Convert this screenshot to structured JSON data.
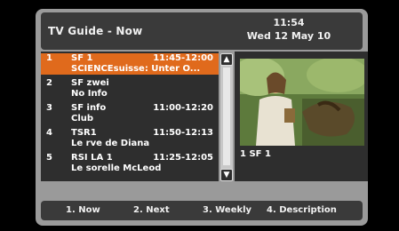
{
  "header": {
    "title": "TV Guide - Now",
    "time": "11:54",
    "date": "Wed 12 May 10"
  },
  "channels": [
    {
      "num": "1",
      "name": "SF 1",
      "time": "11:45-12:00",
      "program": "SCIENCEsuisse: Unter O...",
      "selected": true
    },
    {
      "num": "2",
      "name": "SF zwei",
      "time": "",
      "program": "No Info",
      "selected": false
    },
    {
      "num": "3",
      "name": "SF info",
      "time": "11:00-12:20",
      "program": "Club",
      "selected": false
    },
    {
      "num": "4",
      "name": "TSR1",
      "time": "11:50-12:13",
      "program": "Le rve de Diana",
      "selected": false
    },
    {
      "num": "5",
      "name": "RSI LA 1",
      "time": "11:25-12:05",
      "program": "Le sorelle McLeod",
      "selected": false
    }
  ],
  "preview": {
    "label": "1 SF 1"
  },
  "scrollbar": {
    "up_symbol": "▲",
    "down_symbol": "▼"
  },
  "footer": {
    "tabs": [
      "1. Now",
      "2. Next",
      "3. Weekly",
      "4. Description"
    ]
  },
  "colors": {
    "selected_row": "#e06a1c",
    "panel": "#2e2e2e",
    "frame": "#9a9a9a"
  }
}
